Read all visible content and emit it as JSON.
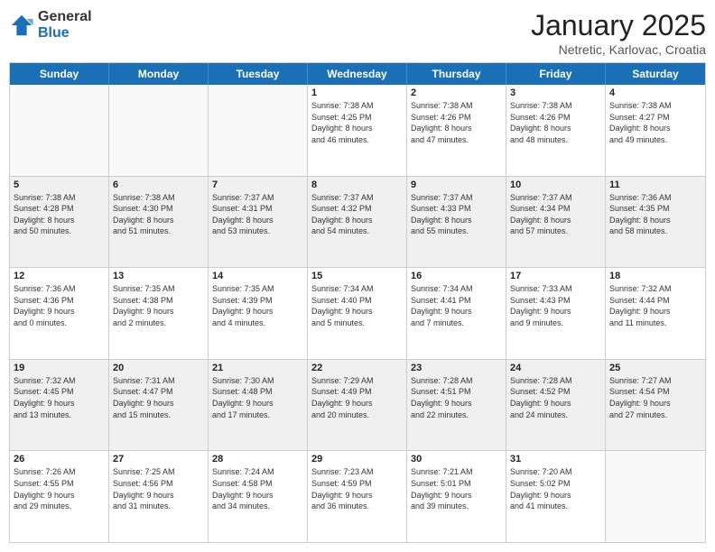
{
  "logo": {
    "general": "General",
    "blue": "Blue"
  },
  "header": {
    "title": "January 2025",
    "subtitle": "Netretic, Karlovac, Croatia"
  },
  "weekdays": [
    "Sunday",
    "Monday",
    "Tuesday",
    "Wednesday",
    "Thursday",
    "Friday",
    "Saturday"
  ],
  "rows": [
    [
      {
        "day": "",
        "info": "",
        "empty": true
      },
      {
        "day": "",
        "info": "",
        "empty": true
      },
      {
        "day": "",
        "info": "",
        "empty": true
      },
      {
        "day": "1",
        "info": "Sunrise: 7:38 AM\nSunset: 4:25 PM\nDaylight: 8 hours\nand 46 minutes.",
        "empty": false
      },
      {
        "day": "2",
        "info": "Sunrise: 7:38 AM\nSunset: 4:26 PM\nDaylight: 8 hours\nand 47 minutes.",
        "empty": false
      },
      {
        "day": "3",
        "info": "Sunrise: 7:38 AM\nSunset: 4:26 PM\nDaylight: 8 hours\nand 48 minutes.",
        "empty": false
      },
      {
        "day": "4",
        "info": "Sunrise: 7:38 AM\nSunset: 4:27 PM\nDaylight: 8 hours\nand 49 minutes.",
        "empty": false
      }
    ],
    [
      {
        "day": "5",
        "info": "Sunrise: 7:38 AM\nSunset: 4:28 PM\nDaylight: 8 hours\nand 50 minutes.",
        "empty": false
      },
      {
        "day": "6",
        "info": "Sunrise: 7:38 AM\nSunset: 4:30 PM\nDaylight: 8 hours\nand 51 minutes.",
        "empty": false
      },
      {
        "day": "7",
        "info": "Sunrise: 7:37 AM\nSunset: 4:31 PM\nDaylight: 8 hours\nand 53 minutes.",
        "empty": false
      },
      {
        "day": "8",
        "info": "Sunrise: 7:37 AM\nSunset: 4:32 PM\nDaylight: 8 hours\nand 54 minutes.",
        "empty": false
      },
      {
        "day": "9",
        "info": "Sunrise: 7:37 AM\nSunset: 4:33 PM\nDaylight: 8 hours\nand 55 minutes.",
        "empty": false
      },
      {
        "day": "10",
        "info": "Sunrise: 7:37 AM\nSunset: 4:34 PM\nDaylight: 8 hours\nand 57 minutes.",
        "empty": false
      },
      {
        "day": "11",
        "info": "Sunrise: 7:36 AM\nSunset: 4:35 PM\nDaylight: 8 hours\nand 58 minutes.",
        "empty": false
      }
    ],
    [
      {
        "day": "12",
        "info": "Sunrise: 7:36 AM\nSunset: 4:36 PM\nDaylight: 9 hours\nand 0 minutes.",
        "empty": false
      },
      {
        "day": "13",
        "info": "Sunrise: 7:35 AM\nSunset: 4:38 PM\nDaylight: 9 hours\nand 2 minutes.",
        "empty": false
      },
      {
        "day": "14",
        "info": "Sunrise: 7:35 AM\nSunset: 4:39 PM\nDaylight: 9 hours\nand 4 minutes.",
        "empty": false
      },
      {
        "day": "15",
        "info": "Sunrise: 7:34 AM\nSunset: 4:40 PM\nDaylight: 9 hours\nand 5 minutes.",
        "empty": false
      },
      {
        "day": "16",
        "info": "Sunrise: 7:34 AM\nSunset: 4:41 PM\nDaylight: 9 hours\nand 7 minutes.",
        "empty": false
      },
      {
        "day": "17",
        "info": "Sunrise: 7:33 AM\nSunset: 4:43 PM\nDaylight: 9 hours\nand 9 minutes.",
        "empty": false
      },
      {
        "day": "18",
        "info": "Sunrise: 7:32 AM\nSunset: 4:44 PM\nDaylight: 9 hours\nand 11 minutes.",
        "empty": false
      }
    ],
    [
      {
        "day": "19",
        "info": "Sunrise: 7:32 AM\nSunset: 4:45 PM\nDaylight: 9 hours\nand 13 minutes.",
        "empty": false
      },
      {
        "day": "20",
        "info": "Sunrise: 7:31 AM\nSunset: 4:47 PM\nDaylight: 9 hours\nand 15 minutes.",
        "empty": false
      },
      {
        "day": "21",
        "info": "Sunrise: 7:30 AM\nSunset: 4:48 PM\nDaylight: 9 hours\nand 17 minutes.",
        "empty": false
      },
      {
        "day": "22",
        "info": "Sunrise: 7:29 AM\nSunset: 4:49 PM\nDaylight: 9 hours\nand 20 minutes.",
        "empty": false
      },
      {
        "day": "23",
        "info": "Sunrise: 7:28 AM\nSunset: 4:51 PM\nDaylight: 9 hours\nand 22 minutes.",
        "empty": false
      },
      {
        "day": "24",
        "info": "Sunrise: 7:28 AM\nSunset: 4:52 PM\nDaylight: 9 hours\nand 24 minutes.",
        "empty": false
      },
      {
        "day": "25",
        "info": "Sunrise: 7:27 AM\nSunset: 4:54 PM\nDaylight: 9 hours\nand 27 minutes.",
        "empty": false
      }
    ],
    [
      {
        "day": "26",
        "info": "Sunrise: 7:26 AM\nSunset: 4:55 PM\nDaylight: 9 hours\nand 29 minutes.",
        "empty": false
      },
      {
        "day": "27",
        "info": "Sunrise: 7:25 AM\nSunset: 4:56 PM\nDaylight: 9 hours\nand 31 minutes.",
        "empty": false
      },
      {
        "day": "28",
        "info": "Sunrise: 7:24 AM\nSunset: 4:58 PM\nDaylight: 9 hours\nand 34 minutes.",
        "empty": false
      },
      {
        "day": "29",
        "info": "Sunrise: 7:23 AM\nSunset: 4:59 PM\nDaylight: 9 hours\nand 36 minutes.",
        "empty": false
      },
      {
        "day": "30",
        "info": "Sunrise: 7:21 AM\nSunset: 5:01 PM\nDaylight: 9 hours\nand 39 minutes.",
        "empty": false
      },
      {
        "day": "31",
        "info": "Sunrise: 7:20 AM\nSunset: 5:02 PM\nDaylight: 9 hours\nand 41 minutes.",
        "empty": false
      },
      {
        "day": "",
        "info": "",
        "empty": true
      }
    ]
  ]
}
